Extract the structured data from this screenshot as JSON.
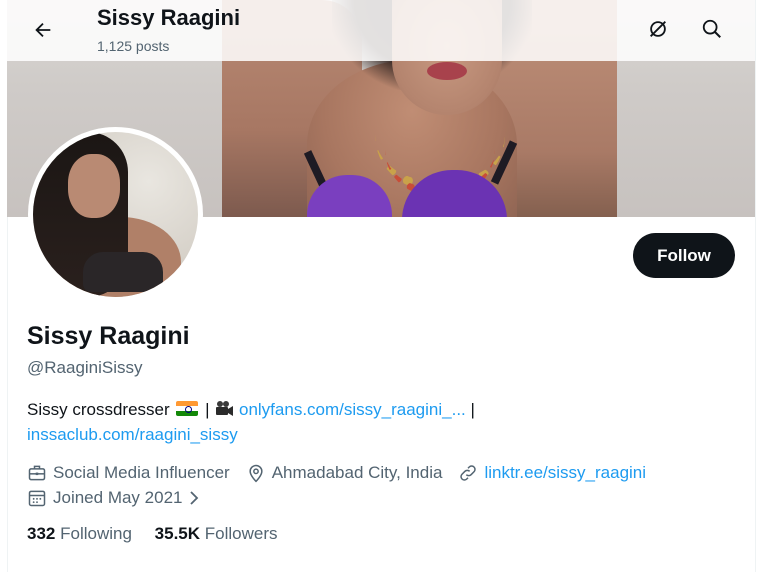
{
  "header": {
    "title": "Sissy Raagini",
    "posts": "1,125 posts"
  },
  "profile": {
    "display_name": "Sissy Raagini",
    "handle": "@RaaginiSissy",
    "follow_label": "Follow",
    "bio": {
      "text_start": "Sissy crossdresser",
      "sep1": "|",
      "link1": "onlyfans.com/sissy_raagini_...",
      "sep2": "|",
      "link2": "inssaclub.com/raagini_sissy"
    },
    "category": "Social Media Influencer",
    "location": "Ahmadabad City, India",
    "website": "linktr.ee/sissy_raagini",
    "joined": "Joined May 2021",
    "following_count": "332",
    "following_label": "Following",
    "followers_count": "35.5K",
    "followers_label": "Followers"
  },
  "colors": {
    "link": "#1d9bf0",
    "text": "#0f1419",
    "secondary": "#536471",
    "button_bg": "#0f1419"
  },
  "icons": [
    "back-arrow-icon",
    "grok-icon",
    "search-icon",
    "briefcase-icon",
    "location-pin-icon",
    "link-icon",
    "calendar-icon",
    "chevron-right-icon",
    "india-flag-icon",
    "movie-camera-icon"
  ]
}
